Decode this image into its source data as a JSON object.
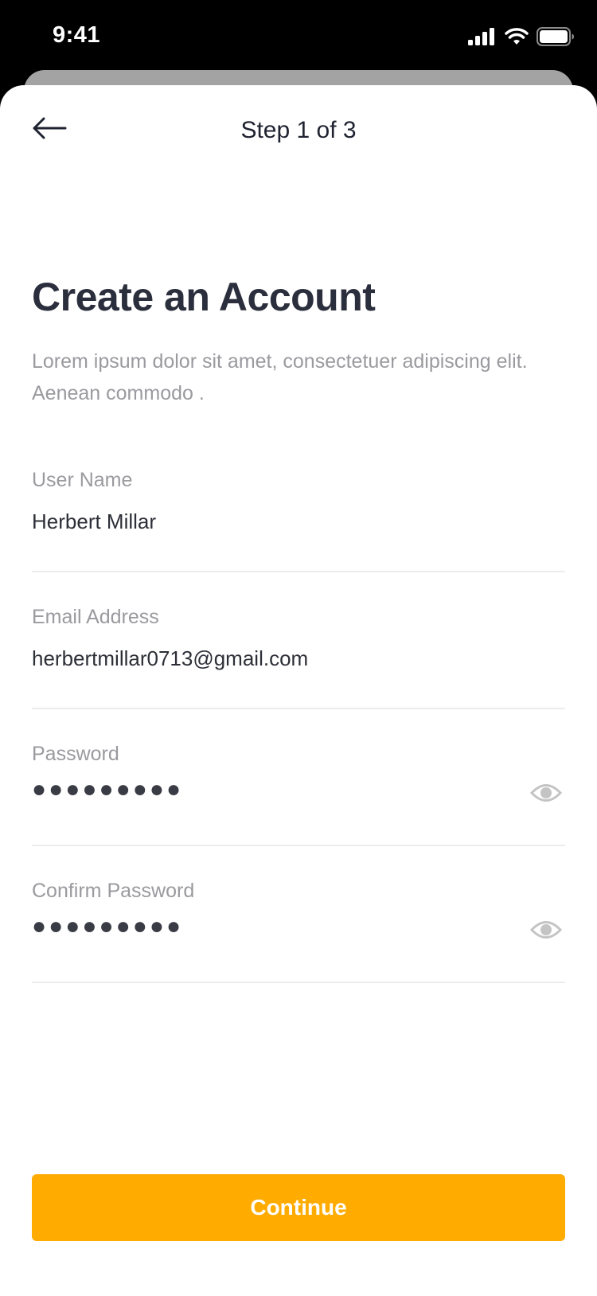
{
  "status_bar": {
    "time": "9:41",
    "icons": [
      "signal-icon",
      "wifi-icon",
      "battery-icon"
    ]
  },
  "nav": {
    "back_icon": "arrow-left-icon",
    "step_label": "Step 1 of 3"
  },
  "header": {
    "title": "Create an Account",
    "subtitle": "Lorem ipsum dolor sit amet, consectetuer adipiscing elit. Aenean commodo ."
  },
  "form": {
    "username": {
      "label": "User Name",
      "value": "Herbert Millar"
    },
    "email": {
      "label": "Email Address",
      "value": "herbertmillar0713@gmail.com"
    },
    "password": {
      "label": "Password",
      "masked_value": "●●●●●●●●●",
      "toggle_icon": "eye-icon"
    },
    "confirm_password": {
      "label": "Confirm Password",
      "masked_value": "●●●●●●●●●",
      "toggle_icon": "eye-icon"
    }
  },
  "actions": {
    "continue_label": "Continue"
  },
  "colors": {
    "accent": "#ffab00",
    "title": "#2b2e3c",
    "muted_text": "#9a9a9f",
    "divider": "#ececec"
  }
}
